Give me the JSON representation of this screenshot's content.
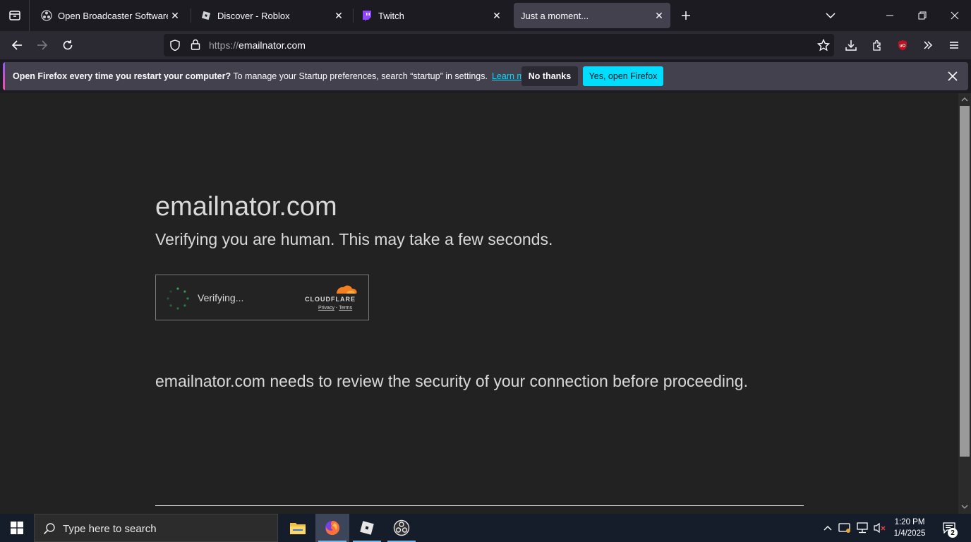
{
  "browser": {
    "tabs": [
      {
        "title": "Open Broadcaster Software | OBS",
        "icon": "obs-icon",
        "active": false
      },
      {
        "title": "Discover - Roblox",
        "icon": "roblox-icon",
        "active": false
      },
      {
        "title": "Twitch",
        "icon": "twitch-icon",
        "active": false
      },
      {
        "title": "Just a moment...",
        "icon": "",
        "active": true
      }
    ],
    "url_protocol": "https://",
    "url_host": "emailnator.com"
  },
  "notification": {
    "bold_text": "Open Firefox every time you restart your computer?",
    "text": " To manage your Startup preferences, search “startup” in settings.",
    "link": "Learn more",
    "no_button": "No thanks",
    "yes_button": "Yes, open Firefox"
  },
  "page": {
    "site_name": "emailnator.com",
    "verify_message": "Verifying you are human. This may take a few seconds.",
    "widget": {
      "status": "Verifying...",
      "brand": "CLOUDFLARE",
      "privacy": "Privacy",
      "separator": "·",
      "terms": "Terms"
    },
    "review_message": "emailnator.com needs to review the security of your connection before proceeding."
  },
  "taskbar": {
    "search_placeholder": "Type here to search",
    "time": "1:20 PM",
    "date": "1/4/2025",
    "notification_count": "2"
  },
  "colors": {
    "accent_cyan": "#00ddff",
    "cloudflare_orange": "#f38020",
    "spinner_green": "#31a35a"
  }
}
